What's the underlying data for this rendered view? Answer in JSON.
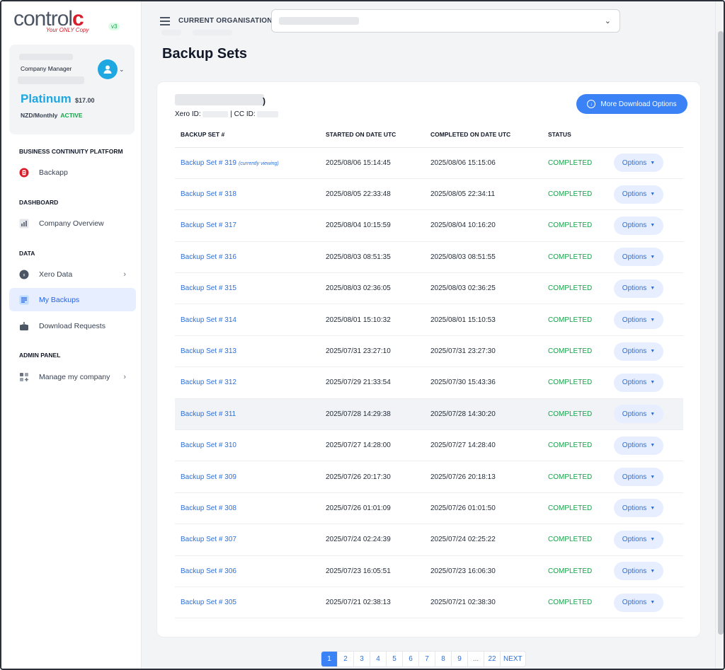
{
  "brand": {
    "logo_text": "control",
    "logo_c": "c",
    "tagline": "Your ONLY Copy",
    "version": "v3"
  },
  "user": {
    "role": "Company Manager",
    "plan": "Platinum",
    "price": "$17.00",
    "billing": "NZD/Monthly",
    "status": "ACTIVE"
  },
  "sidebar": {
    "sections": [
      {
        "label": "BUSINESS CONTINUITY PLATFORM"
      },
      {
        "label": "DASHBOARD"
      },
      {
        "label": "DATA"
      },
      {
        "label": "ADMIN PANEL"
      }
    ],
    "items": [
      {
        "label": "Backapp",
        "icon": "backapp-icon"
      },
      {
        "label": "Company Overview",
        "icon": "chart-icon"
      },
      {
        "label": "Xero Data",
        "icon": "xero-icon"
      },
      {
        "label": "My Backups",
        "icon": "backups-icon"
      },
      {
        "label": "Download Requests",
        "icon": "download-box-icon"
      },
      {
        "label": "Manage my company",
        "icon": "grid-plus-icon"
      }
    ]
  },
  "header": {
    "org_label": "CURRENT ORGANISATION"
  },
  "page": {
    "title": "Backup Sets"
  },
  "card": {
    "org_suffix": ")",
    "xero_id_label": "Xero ID:",
    "cc_id_label": "| CC ID:",
    "more_button": "More Download Options"
  },
  "table": {
    "headers": [
      "BACKUP SET #",
      "STARTED ON DATE UTC",
      "COMPLETED ON DATE UTC",
      "STATUS",
      ""
    ],
    "option_label": "Options",
    "viewing_note": "(currently viewing)",
    "rows": [
      {
        "name": "Backup Set # 319",
        "started": "2025/08/06 15:14:45",
        "completed": "2025/08/06 15:15:06",
        "status": "COMPLETED"
      },
      {
        "name": "Backup Set # 318",
        "started": "2025/08/05 22:33:48",
        "completed": "2025/08/05 22:34:11",
        "status": "COMPLETED"
      },
      {
        "name": "Backup Set # 317",
        "started": "2025/08/04 10:15:59",
        "completed": "2025/08/04 10:16:20",
        "status": "COMPLETED"
      },
      {
        "name": "Backup Set # 316",
        "started": "2025/08/03 08:51:35",
        "completed": "2025/08/03 08:51:55",
        "status": "COMPLETED"
      },
      {
        "name": "Backup Set # 315",
        "started": "2025/08/03 02:36:05",
        "completed": "2025/08/03 02:36:25",
        "status": "COMPLETED"
      },
      {
        "name": "Backup Set # 314",
        "started": "2025/08/01 15:10:32",
        "completed": "2025/08/01 15:10:53",
        "status": "COMPLETED"
      },
      {
        "name": "Backup Set # 313",
        "started": "2025/07/31 23:27:10",
        "completed": "2025/07/31 23:27:30",
        "status": "COMPLETED"
      },
      {
        "name": "Backup Set # 312",
        "started": "2025/07/29 21:33:54",
        "completed": "2025/07/30 15:43:36",
        "status": "COMPLETED"
      },
      {
        "name": "Backup Set # 311",
        "started": "2025/07/28 14:29:38",
        "completed": "2025/07/28 14:30:20",
        "status": "COMPLETED"
      },
      {
        "name": "Backup Set # 310",
        "started": "2025/07/27 14:28:00",
        "completed": "2025/07/27 14:28:40",
        "status": "COMPLETED"
      },
      {
        "name": "Backup Set # 309",
        "started": "2025/07/26 20:17:30",
        "completed": "2025/07/26 20:18:13",
        "status": "COMPLETED"
      },
      {
        "name": "Backup Set # 308",
        "started": "2025/07/26 01:01:09",
        "completed": "2025/07/26 01:01:50",
        "status": "COMPLETED"
      },
      {
        "name": "Backup Set # 307",
        "started": "2025/07/24 02:24:39",
        "completed": "2025/07/24 02:25:22",
        "status": "COMPLETED"
      },
      {
        "name": "Backup Set # 306",
        "started": "2025/07/23 16:05:51",
        "completed": "2025/07/23 16:06:30",
        "status": "COMPLETED"
      },
      {
        "name": "Backup Set # 305",
        "started": "2025/07/21 02:38:13",
        "completed": "2025/07/21 02:38:30",
        "status": "COMPLETED"
      }
    ]
  },
  "pagination": {
    "pages": [
      "1",
      "2",
      "3",
      "4",
      "5",
      "6",
      "7",
      "8",
      "9",
      "...",
      "22",
      "NEXT"
    ],
    "current": "1"
  },
  "colors": {
    "accent": "#3b82f6",
    "link": "#2f6fd6",
    "success": "#16a34a",
    "brand_red": "#d81e2a",
    "plan_blue": "#1ea7e1"
  }
}
